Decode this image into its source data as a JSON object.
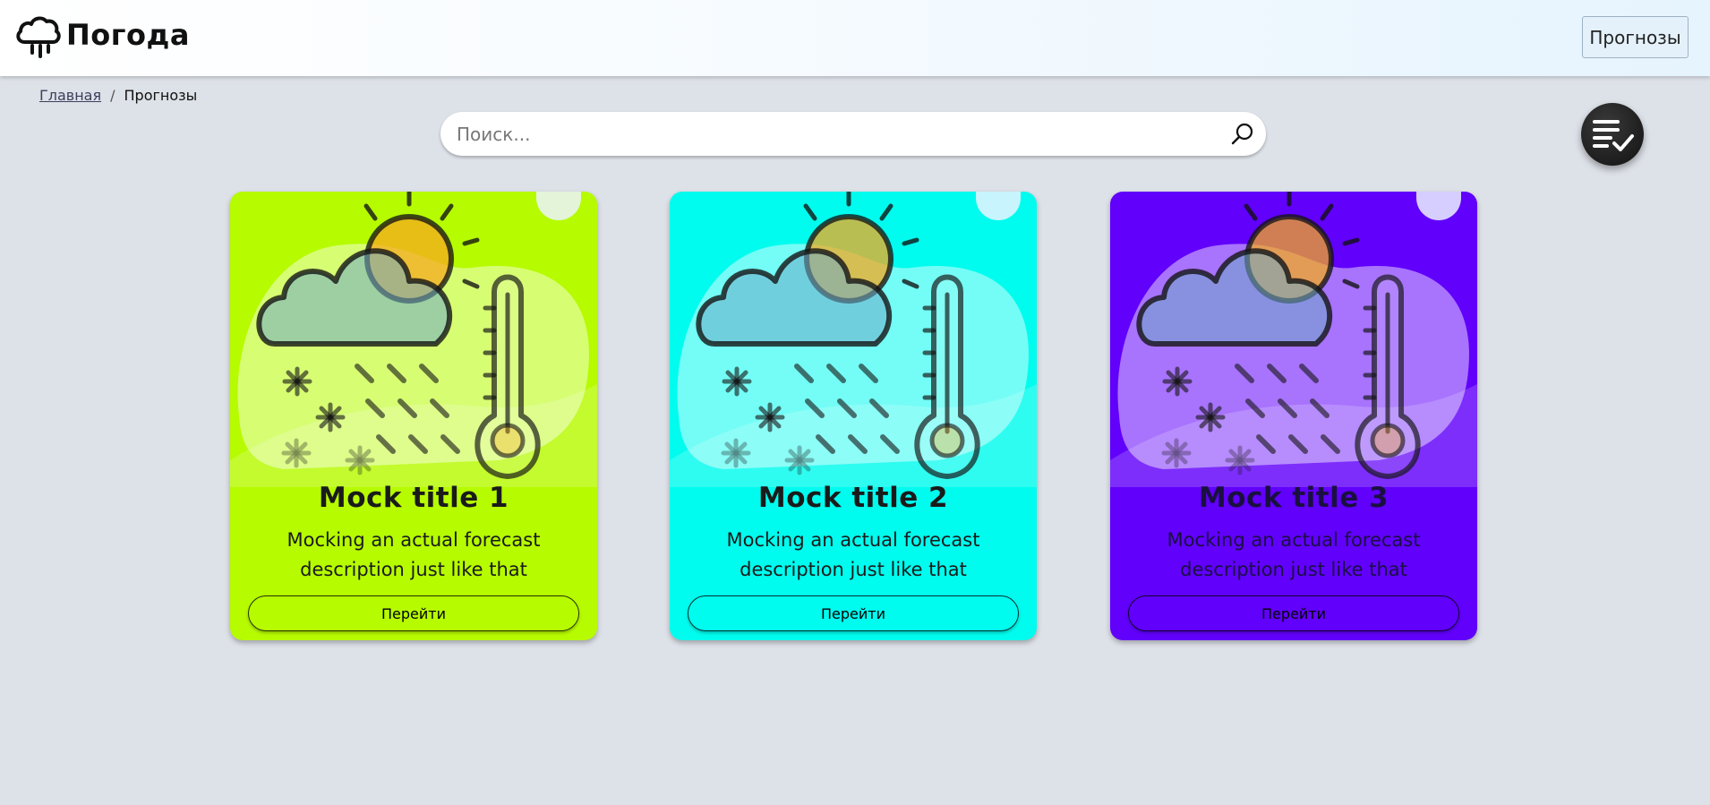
{
  "app": {
    "title": "Погода"
  },
  "header": {
    "nav_button_label": "Прогнозы"
  },
  "breadcrumb": {
    "home": "Главная",
    "separator": "/",
    "current": "Прогнозы"
  },
  "search": {
    "placeholder": "Поиск..."
  },
  "cards": [
    {
      "title": "Mock title 1",
      "description": "Mocking an actual forecast description just like that",
      "button_label": "Перейти",
      "color": "#b6fb00",
      "text_color": "#1a1a1a"
    },
    {
      "title": "Mock title 2",
      "description": "Mocking an actual forecast description just like that",
      "button_label": "Перейти",
      "color": "#00fcee",
      "text_color": "#1a1a1a"
    },
    {
      "title": "Mock title 3",
      "description": "Mocking an actual forecast description just like that",
      "button_label": "Перейти",
      "color": "#6100fb",
      "text_color": "#1a1040"
    }
  ],
  "icons": {
    "logo": "cloud-rain-icon",
    "search": "search-icon",
    "fab": "checklist-icon",
    "card": "weather-illustration"
  }
}
